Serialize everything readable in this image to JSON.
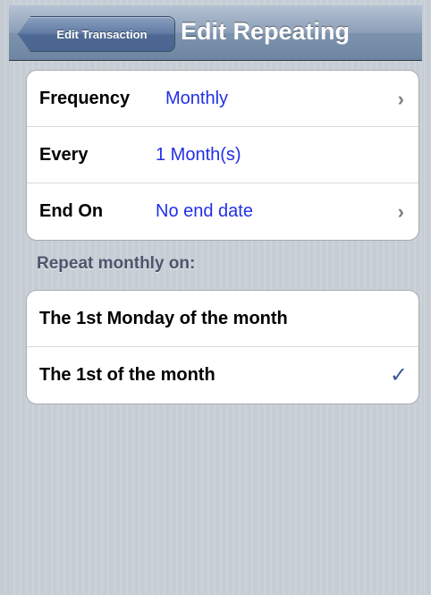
{
  "navbar": {
    "back_label": "Edit Transaction",
    "title": "Edit Repeating"
  },
  "settings": {
    "frequency": {
      "label": "Frequency",
      "value": "Monthly"
    },
    "every": {
      "label": "Every",
      "value": "1 Month(s)"
    },
    "end_on": {
      "label": "End On",
      "value": "No end date"
    }
  },
  "repeat_section": {
    "header": "Repeat monthly on:",
    "options": [
      {
        "label": "The 1st Monday of the month",
        "selected": false
      },
      {
        "label": "The 1st of the month",
        "selected": true
      }
    ]
  },
  "icons": {
    "chevron": "chevron-right-icon",
    "check": "checkmark-icon"
  },
  "colors": {
    "value_blue": "#2130e6",
    "check_blue": "#3a5a96",
    "nav_bar": "#6e86a3"
  }
}
